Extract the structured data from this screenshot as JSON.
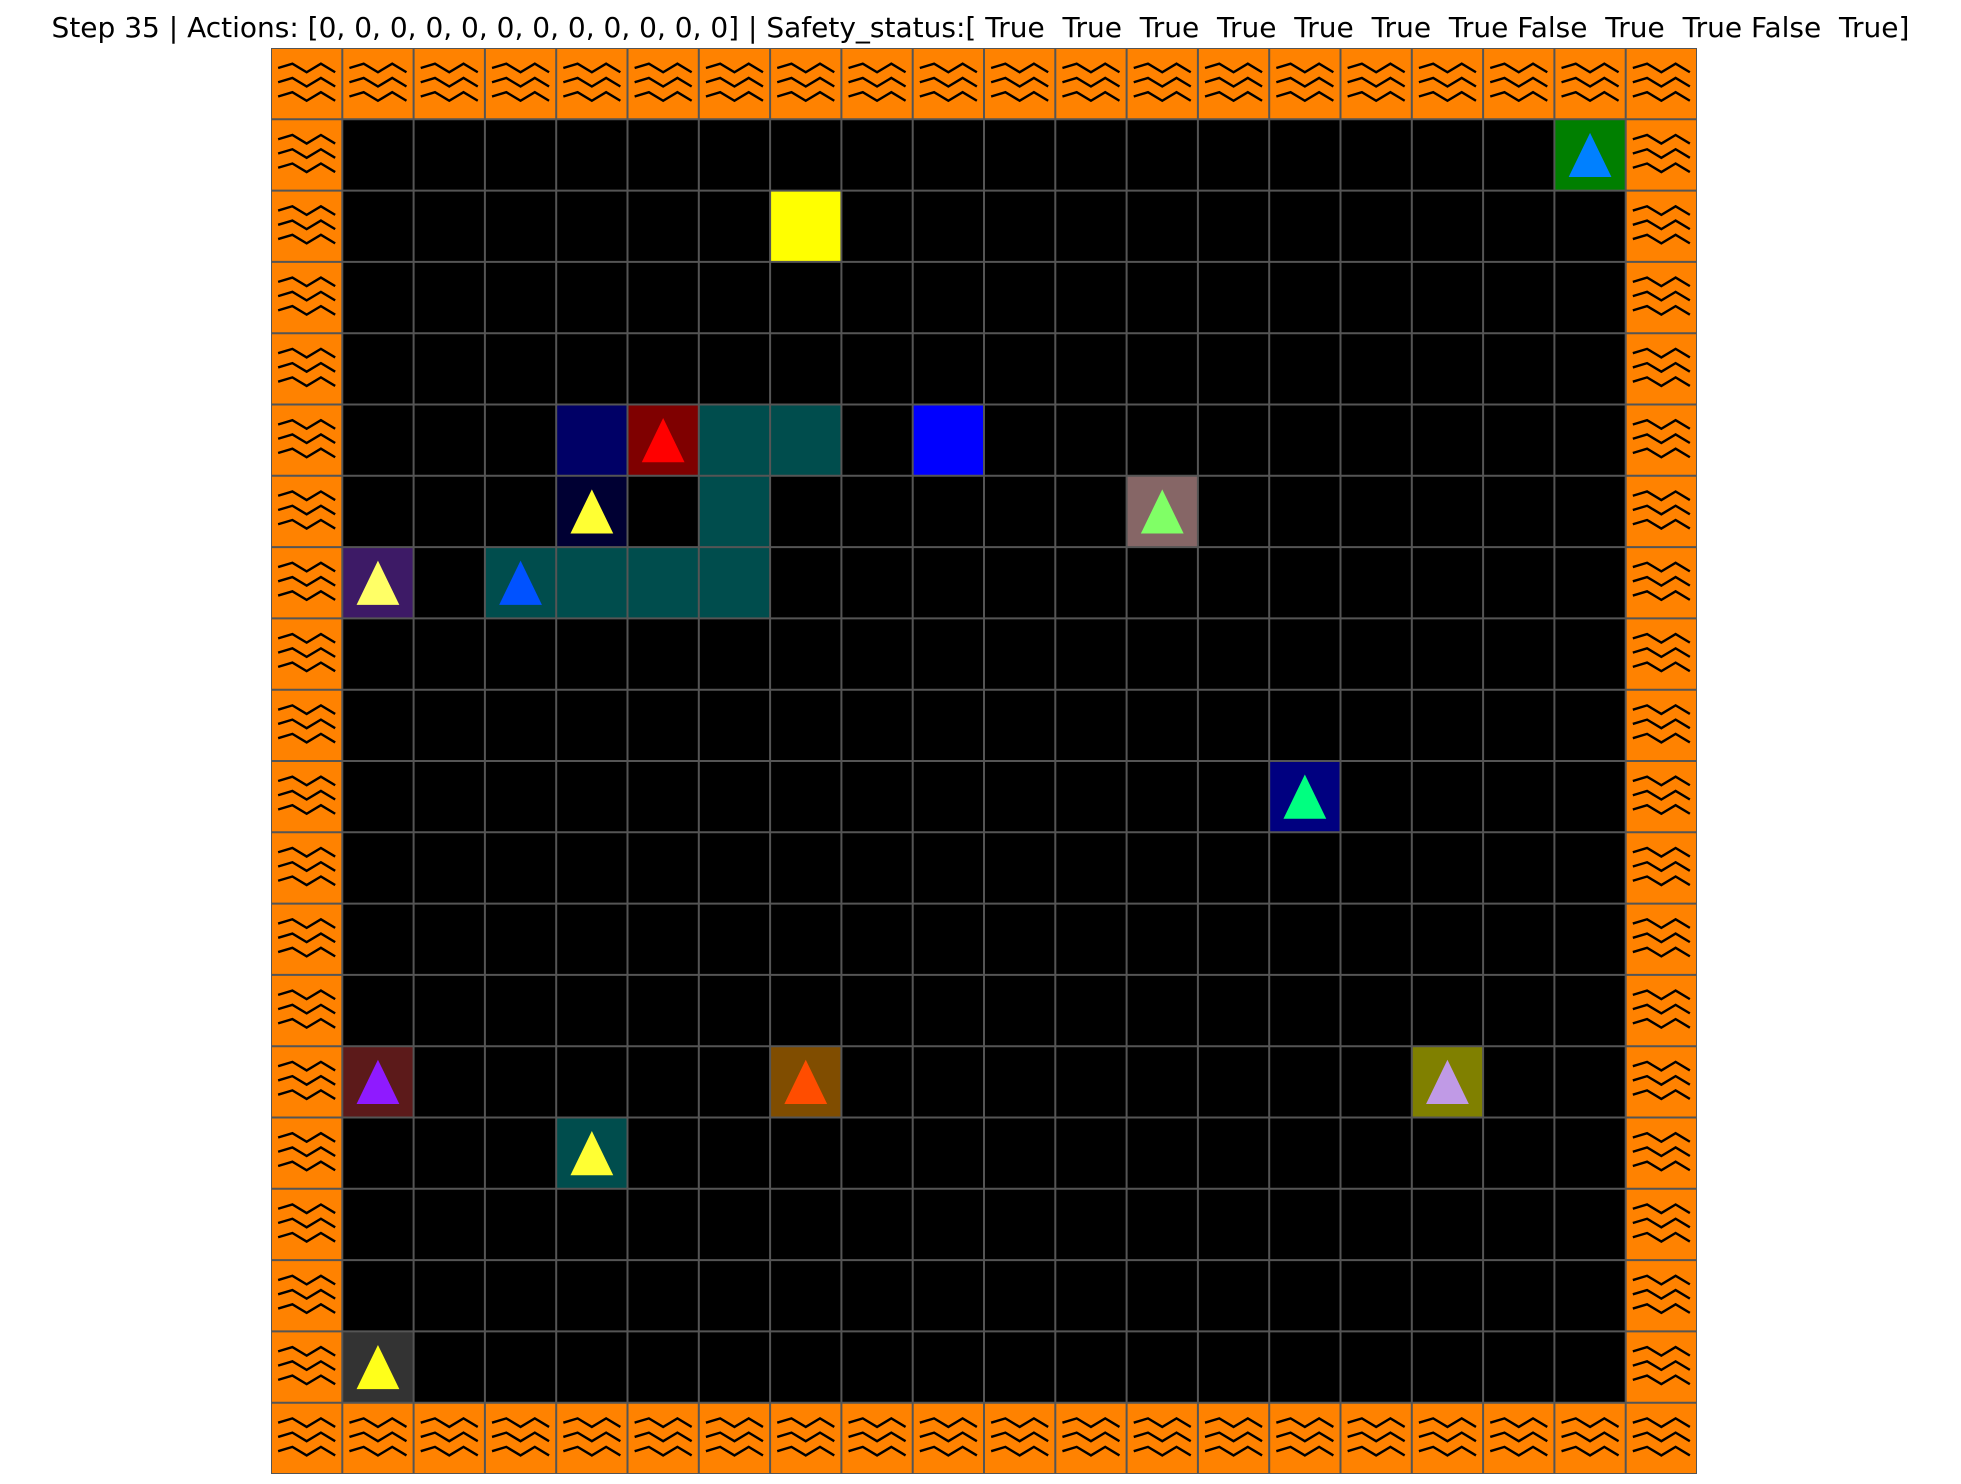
{
  "header": {
    "title": "Step 35 | Actions: [0, 0, 0, 0, 0, 0, 0, 0, 0, 0, 0, 0] | Safety_status:[ True  True  True  True  True  True  True False  True  True False  True]"
  },
  "grid": {
    "cols": 20,
    "rows": 20,
    "colors": {
      "floor": "#000000",
      "grid_line": "#555555",
      "lava": "#ff8200",
      "lava_wave": "#000000"
    }
  },
  "cells": [
    {
      "col": 18,
      "row": 1,
      "bg": "#007f00",
      "agent": "#0080ff",
      "name": "agent-1-cell"
    },
    {
      "col": 7,
      "row": 2,
      "bg": "#ffff00",
      "name": "yellow-goal-cell"
    },
    {
      "col": 4,
      "row": 5,
      "bg": "#000066",
      "name": "navy-cell"
    },
    {
      "col": 5,
      "row": 5,
      "bg": "#7f0000",
      "agent": "#ff0000",
      "name": "agent-2-cell"
    },
    {
      "col": 6,
      "row": 5,
      "bg": "#004d4d",
      "name": "teal-cell"
    },
    {
      "col": 7,
      "row": 5,
      "bg": "#004d4d",
      "name": "teal-cell"
    },
    {
      "col": 9,
      "row": 5,
      "bg": "#0000ff",
      "name": "blue-goal-cell"
    },
    {
      "col": 4,
      "row": 6,
      "bg": "#000033",
      "agent": "#ffff33",
      "name": "agent-3-cell"
    },
    {
      "col": 6,
      "row": 6,
      "bg": "#004d4d",
      "name": "teal-cell"
    },
    {
      "col": 12,
      "row": 6,
      "bg": "#866666",
      "agent": "#80ff66",
      "name": "agent-4-cell"
    },
    {
      "col": 1,
      "row": 7,
      "bg": "#3d1a66",
      "agent": "#ffff66",
      "name": "agent-5-cell"
    },
    {
      "col": 3,
      "row": 7,
      "bg": "#004d4d",
      "agent": "#0052ff",
      "name": "agent-6-cell"
    },
    {
      "col": 4,
      "row": 7,
      "bg": "#004d4d",
      "name": "teal-cell"
    },
    {
      "col": 5,
      "row": 7,
      "bg": "#004d4d",
      "name": "teal-cell"
    },
    {
      "col": 6,
      "row": 7,
      "bg": "#004d4d",
      "name": "teal-cell"
    },
    {
      "col": 14,
      "row": 10,
      "bg": "#000080",
      "agent": "#00ff80",
      "name": "agent-7-cell"
    },
    {
      "col": 1,
      "row": 14,
      "bg": "#5c1a1a",
      "agent": "#8f1aff",
      "name": "agent-8-cell"
    },
    {
      "col": 7,
      "row": 14,
      "bg": "#804d00",
      "agent": "#ff4d00",
      "name": "agent-9-cell"
    },
    {
      "col": 16,
      "row": 14,
      "bg": "#808000",
      "agent": "#c09ae6",
      "name": "agent-10-cell"
    },
    {
      "col": 4,
      "row": 15,
      "bg": "#004d4d",
      "agent": "#ffff33",
      "name": "agent-11-cell"
    },
    {
      "col": 1,
      "row": 18,
      "bg": "#333333",
      "agent": "#ffff1a",
      "name": "agent-12-cell"
    }
  ]
}
